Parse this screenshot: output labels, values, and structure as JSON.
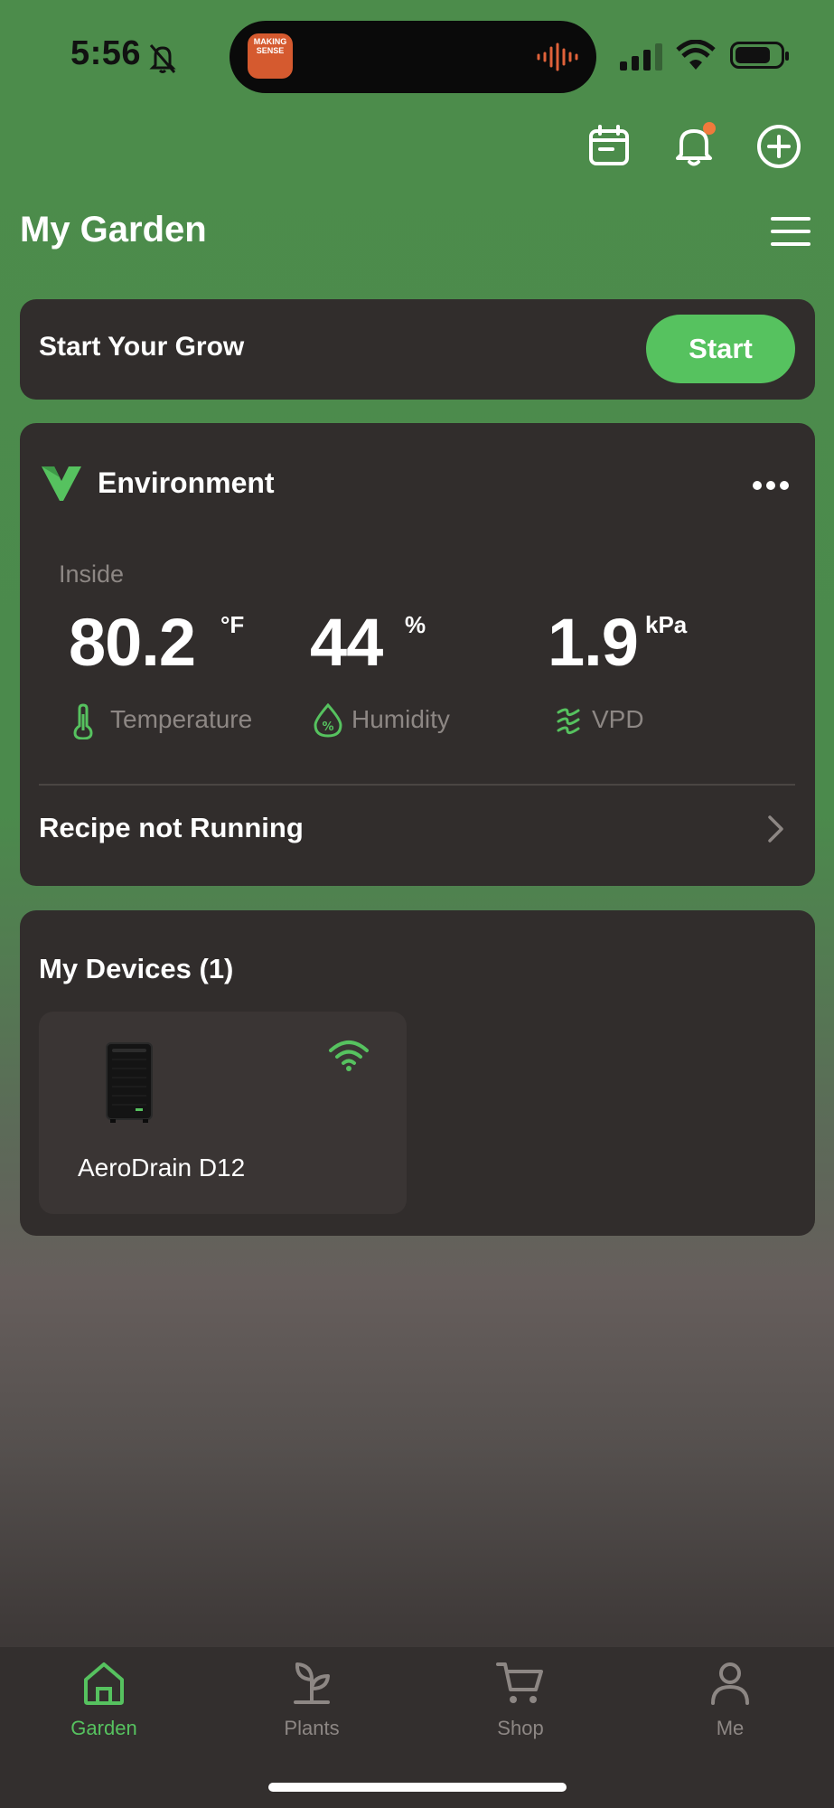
{
  "status_bar": {
    "time": "5:56",
    "island_app_label": "MAKING SENSE"
  },
  "header": {
    "title": "My Garden"
  },
  "start_card": {
    "label": "Start Your Grow",
    "button_label": "Start"
  },
  "environment": {
    "title": "Environment",
    "location": "Inside",
    "metrics": [
      {
        "value": "80.2",
        "unit": "°F",
        "label": "Temperature",
        "icon": "thermometer-icon"
      },
      {
        "value": "44",
        "unit": "%",
        "label": "Humidity",
        "icon": "humidity-drop-icon"
      },
      {
        "value": "1.9",
        "unit": "kPa",
        "label": "VPD",
        "icon": "vpd-wave-icon"
      }
    ],
    "recipe_status": "Recipe not Running"
  },
  "devices": {
    "title": "My Devices (1)",
    "items": [
      {
        "name": "AeroDrain D12",
        "status_icon": "wifi-connected-icon"
      }
    ]
  },
  "tabbar": {
    "tabs": [
      {
        "label": "Garden",
        "icon": "home-icon",
        "active": true
      },
      {
        "label": "Plants",
        "icon": "sprout-icon",
        "active": false
      },
      {
        "label": "Shop",
        "icon": "cart-icon",
        "active": false
      },
      {
        "label": "Me",
        "icon": "person-icon",
        "active": false
      }
    ]
  },
  "colors": {
    "accent_green": "#56c25f",
    "card_bg": "#312d2c",
    "notification_dot": "#f07a3c"
  }
}
